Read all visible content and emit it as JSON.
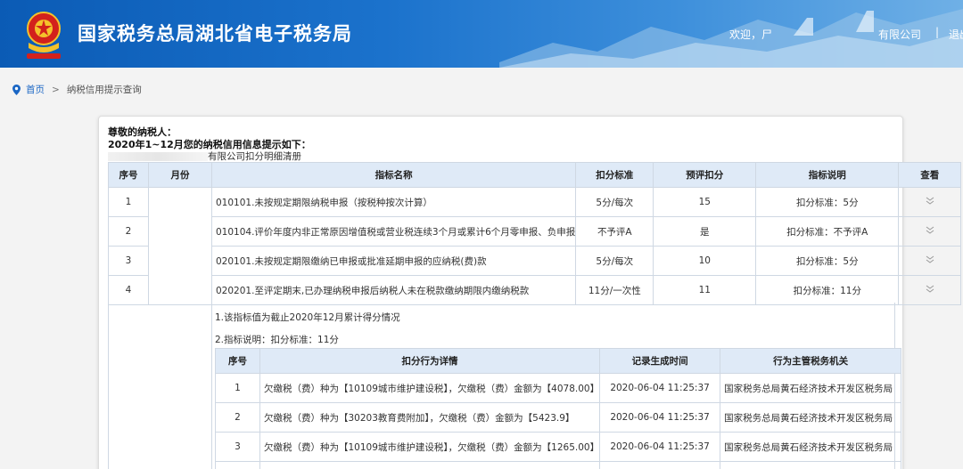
{
  "header": {
    "site_title": "国家税务总局湖北省电子税务局",
    "welcome": "欢迎，",
    "welcome_name_hint": "尸",
    "company_tail": "有限公司",
    "separator": "|",
    "logout": "退出"
  },
  "breadcrumb": {
    "home": "首页",
    "arrow": ">",
    "current": "纳税信用提示查询"
  },
  "content": {
    "greeting_line1": "尊敬的纳税人：",
    "greeting_line2": "2020年1~12月您的纳税信用信息提示如下：",
    "company_suffix": "有限公司扣分明细清册"
  },
  "main_table": {
    "headers": [
      "序号",
      "月份",
      "指标名称",
      "扣分标准",
      "预评扣分",
      "指标说明",
      "查看"
    ],
    "rows": [
      {
        "seq": "1",
        "indicator": "010101.未按规定期限纳税申报（按税种按次计算）",
        "standard": "5分/每次",
        "deduction": "15",
        "note": "扣分标准：5分"
      },
      {
        "seq": "2",
        "indicator": "010104.评价年度内非正常原因增值税或营业税连续3个月或累计6个月零申报、负申报",
        "standard": "不予评A",
        "deduction": "是",
        "note": "扣分标准：不予评A"
      },
      {
        "seq": "3",
        "indicator": "020101.未按规定期限缴纳已申报或批准延期申报的应纳税(费)款",
        "standard": "5分/每次",
        "deduction": "10",
        "note": "扣分标准：5分"
      },
      {
        "seq": "4",
        "indicator": "020201.至评定期末,已办理纳税申报后纳税人未在税款缴纳期限内缴纳税款",
        "standard": "11分/一次性",
        "deduction": "11",
        "note": "扣分标准：11分"
      }
    ]
  },
  "detail": {
    "note1": "1.该指标值为截止2020年12月累计得分情况",
    "note2": "2.指标说明：扣分标准：11分",
    "headers": [
      "序号",
      "扣分行为详情",
      "记录生成时间",
      "行为主管税务机关"
    ],
    "rows": [
      {
        "seq": "1",
        "detail": "欠缴税（费）种为【10109城市维护建设税】，欠缴税（费）金额为【4078.00】",
        "time": "2020-06-04 11:25:37",
        "office": "国家税务总局黄石经济技术开发区税务局"
      },
      {
        "seq": "2",
        "detail": "欠缴税（费）种为【30203教育费附加】，欠缴税（费）金额为【5423.9】",
        "time": "2020-06-04 11:25:37",
        "office": "国家税务总局黄石经济技术开发区税务局"
      },
      {
        "seq": "3",
        "detail": "欠缴税（费）种为【10109城市维护建设税】，欠缴税（费）金额为【1265.00】",
        "time": "2020-06-04 11:25:37",
        "office": "国家税务总局黄石经济技术开发区税务局"
      }
    ]
  },
  "colors": {
    "header_blue": "#1b72cc",
    "table_header_bg": "#dfeaf7",
    "link_blue": "#1a66c4"
  }
}
